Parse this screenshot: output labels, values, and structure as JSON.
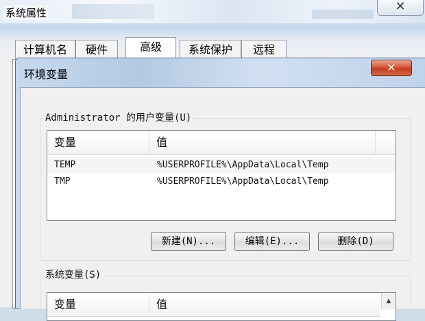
{
  "outer_window": {
    "title": "系统属性",
    "close_glyph": "✕",
    "tabs": [
      {
        "label": "计算机名",
        "active": false
      },
      {
        "label": "硬件",
        "active": false
      },
      {
        "label": "高级",
        "active": true
      },
      {
        "label": "系统保护",
        "active": false
      },
      {
        "label": "远程",
        "active": false
      }
    ]
  },
  "dialog": {
    "title": "环境变量",
    "close_glyph": "✕",
    "user_vars": {
      "group_label": "Administrator 的用户变量(U)",
      "columns": [
        "变量",
        "值"
      ],
      "rows": [
        {
          "name": "TEMP",
          "value": "%USERPROFILE%\\AppData\\Local\\Temp"
        },
        {
          "name": "TMP",
          "value": "%USERPROFILE%\\AppData\\Local\\Temp"
        }
      ],
      "buttons": {
        "new": "新建(N)...",
        "edit": "编辑(E)...",
        "delete": "删除(D)"
      }
    },
    "system_vars": {
      "group_label": "系统变量(S)",
      "columns": [
        "变量",
        "值"
      ],
      "scroll_up_glyph": "▲"
    }
  }
}
